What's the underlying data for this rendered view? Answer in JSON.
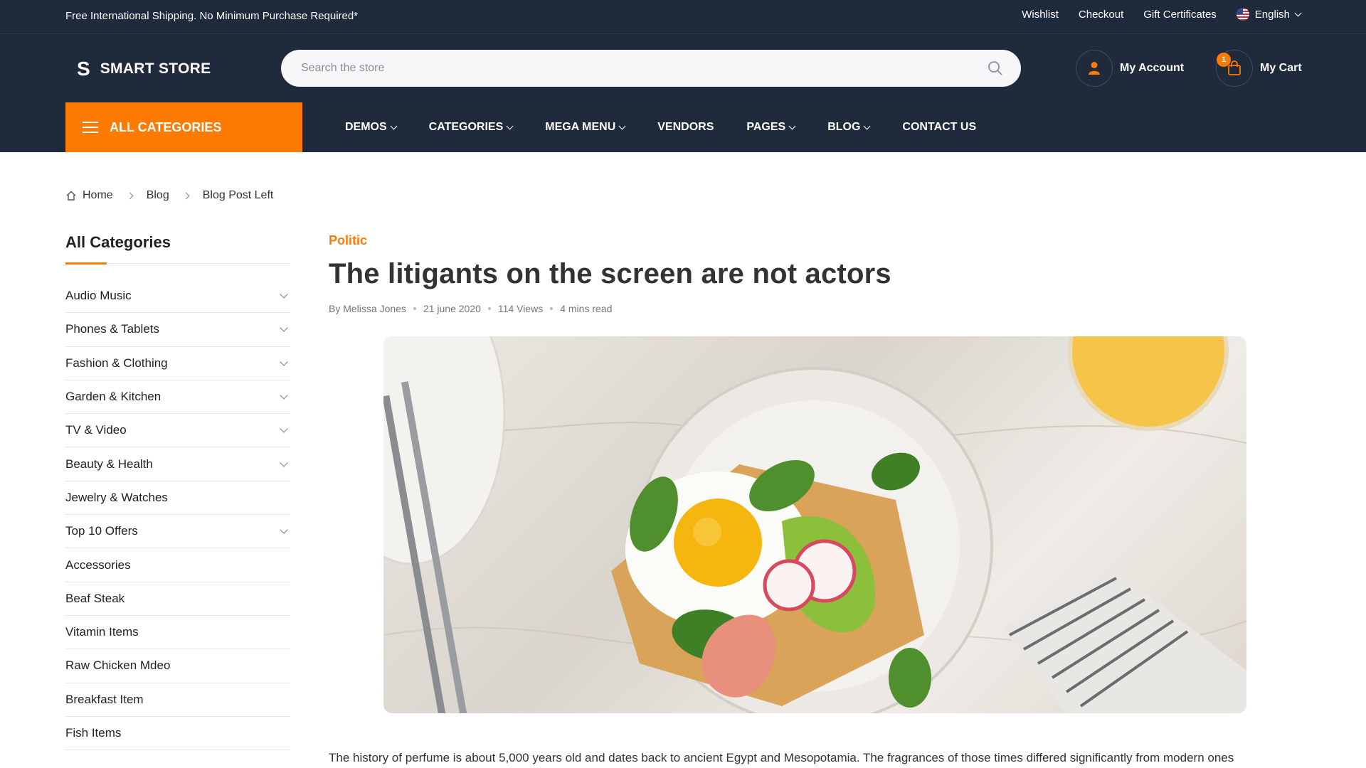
{
  "topbar": {
    "promo": "Free International Shipping. No Minimum Purchase Required*",
    "links": [
      "Wishlist",
      "Checkout",
      "Gift Certificates"
    ],
    "language": "English"
  },
  "header": {
    "logo_mark": "S",
    "logo_name": "SMART STORE",
    "search_placeholder": "Search the store",
    "account_label": "My Account",
    "cart_label": "My Cart",
    "cart_count": "1"
  },
  "nav": {
    "all_categories": "ALL CATEGORIES",
    "items": [
      {
        "label": "DEMOS",
        "dropdown": true
      },
      {
        "label": "CATEGORIES",
        "dropdown": true
      },
      {
        "label": "MEGA MENU",
        "dropdown": true
      },
      {
        "label": "VENDORS",
        "dropdown": false
      },
      {
        "label": "PAGES",
        "dropdown": true
      },
      {
        "label": "BLOG",
        "dropdown": true
      },
      {
        "label": "CONTACT US",
        "dropdown": false
      }
    ]
  },
  "breadcrumb": [
    "Home",
    "Blog",
    "Blog Post Left"
  ],
  "sidebar": {
    "title": "All Categories",
    "categories": [
      {
        "label": "Audio Music",
        "expandable": true
      },
      {
        "label": "Phones & Tablets",
        "expandable": true
      },
      {
        "label": "Fashion & Clothing",
        "expandable": true
      },
      {
        "label": "Garden & Kitchen",
        "expandable": true
      },
      {
        "label": "TV & Video",
        "expandable": true
      },
      {
        "label": "Beauty & Health",
        "expandable": true
      },
      {
        "label": "Jewelry & Watches",
        "expandable": false
      },
      {
        "label": "Top 10 Offers",
        "expandable": true
      },
      {
        "label": "Accessories",
        "expandable": false
      },
      {
        "label": "Beaf Steak",
        "expandable": false
      },
      {
        "label": "Vitamin Items",
        "expandable": false
      },
      {
        "label": "Raw Chicken Mdeo",
        "expandable": false
      },
      {
        "label": "Breakfast Item",
        "expandable": false
      },
      {
        "label": "Fish Items",
        "expandable": false
      }
    ]
  },
  "article": {
    "category": "Politic",
    "title": "The litigants on the screen are not actors",
    "author": "By Melissa Jones",
    "date": "21 june 2020",
    "views": "114 Views",
    "read_time": "4 mins read",
    "body": "The history of perfume is about 5,000 years old and dates back to ancient Egypt and Mesopotamia. The fragrances of those times differed significantly from modern ones"
  },
  "colors": {
    "dark": "#1f2a3c",
    "accent": "#ff7a00"
  }
}
